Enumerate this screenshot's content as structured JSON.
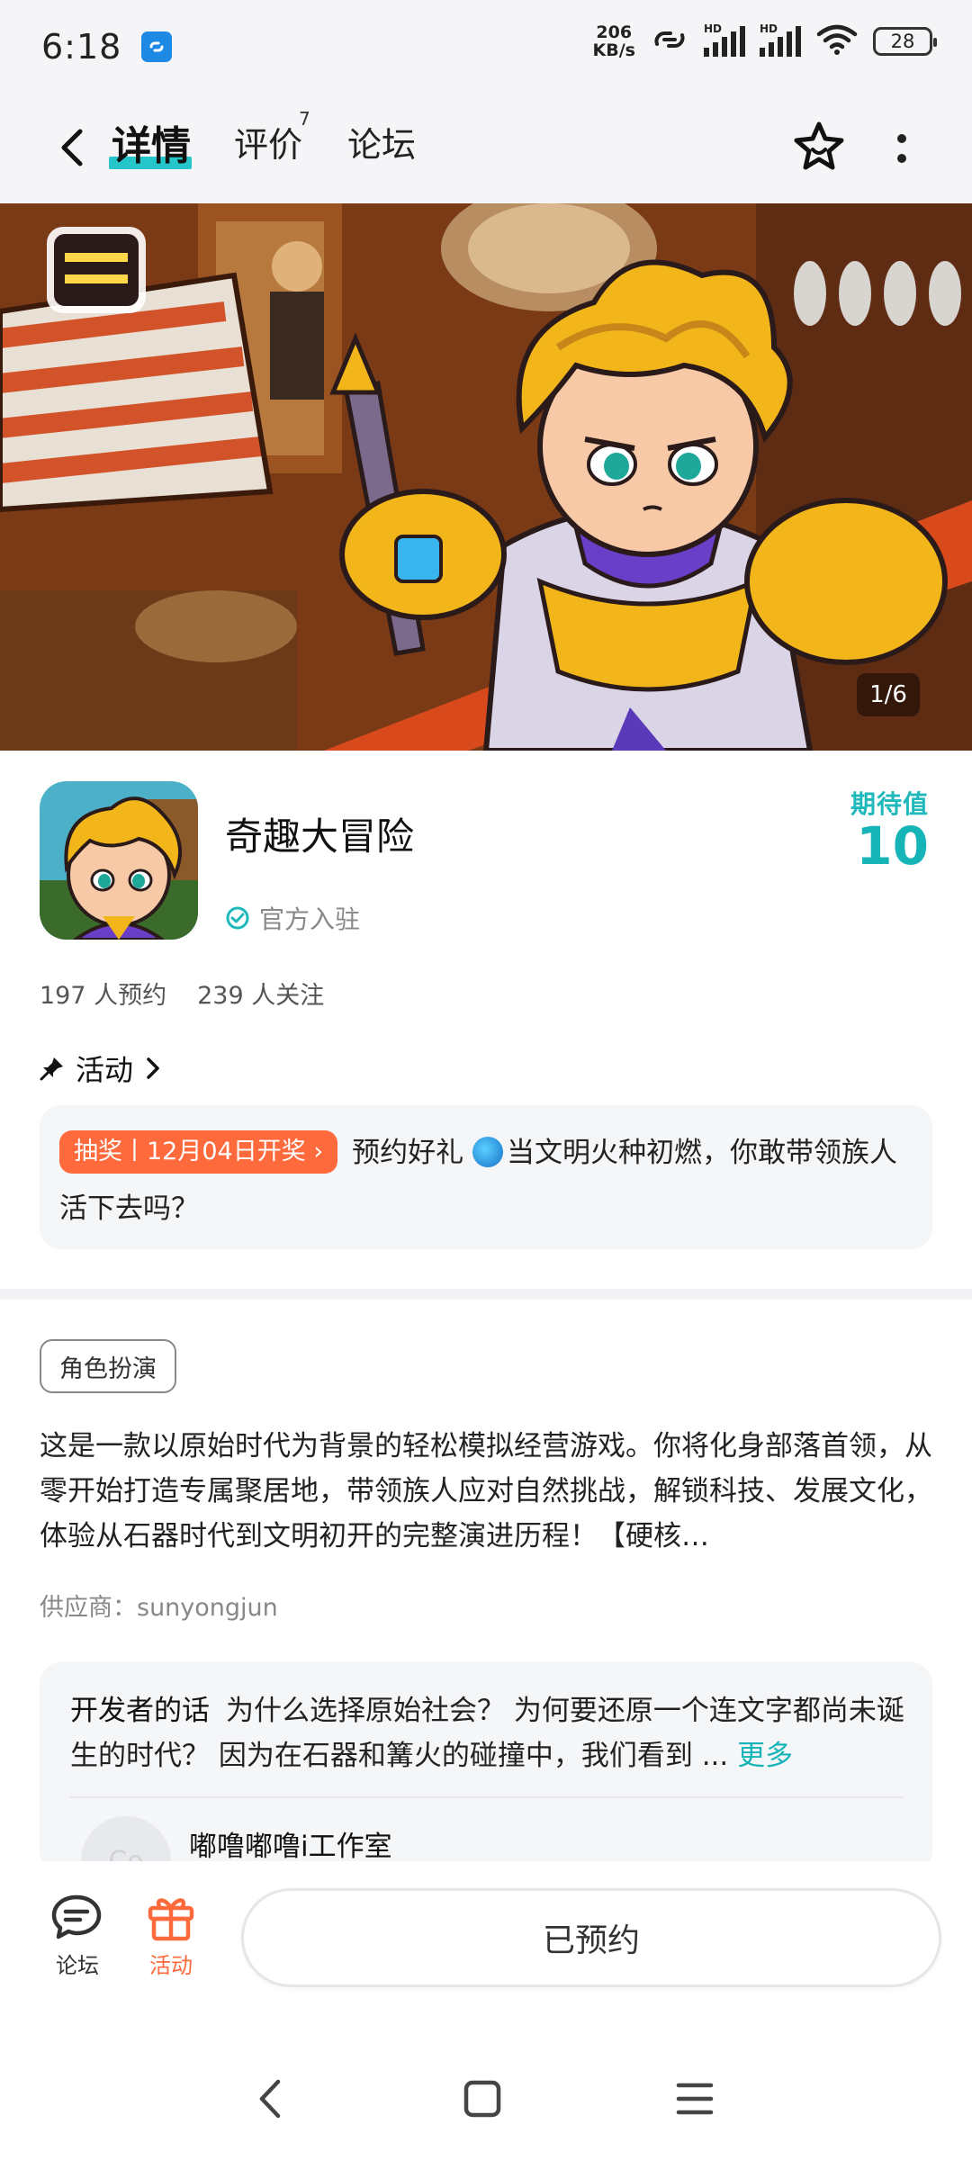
{
  "status_bar": {
    "time": "6:18",
    "net_speed_value": "206",
    "net_speed_unit": "KB/s",
    "hd_label": "HD",
    "battery": "28"
  },
  "nav": {
    "tabs": [
      {
        "label": "详情",
        "active": true
      },
      {
        "label": "评价",
        "count": "7"
      },
      {
        "label": "论坛"
      }
    ]
  },
  "banner": {
    "counter": "1/6"
  },
  "game": {
    "title": "奇趣大冒险",
    "official_label": "官方入驻",
    "expectation_label": "期待值",
    "expectation_value": "10",
    "reservations": "197 人预约",
    "followers": "239 人关注"
  },
  "activity": {
    "heading": "活动",
    "tag": "抽奖丨12月04日开奖",
    "text_lead": "预约好礼",
    "text": "当文明火种初燃，你敢带领族人活下去吗？"
  },
  "details": {
    "genre_tag": "角色扮演",
    "description": "这是一款以原始时代为背景的轻松模拟经营游戏。你将化身部落首领，从零开始打造专属聚居地，带领族人应对自然挑战，解锁科技、发展文化，体验从石器时代到文明初开的完整演进历程！【硬核…",
    "supplier": "供应商：sunyongjun"
  },
  "developer": {
    "label": "开发者的话",
    "text": "为什么选择原始社会？ 为何要还原一个连文字都尚未诞生的时代？ 因为在石器和篝火的碰撞中，我们看到 ...",
    "more": "更多",
    "studio": "嘟噜嘟噜i工作室",
    "avatar_text": "Co"
  },
  "bottom_bar": {
    "forum_label": "论坛",
    "activity_label": "活动",
    "reserved_label": "已预约"
  },
  "colors": {
    "accent": "#16b4b7",
    "orange": "#ff6a3c"
  }
}
